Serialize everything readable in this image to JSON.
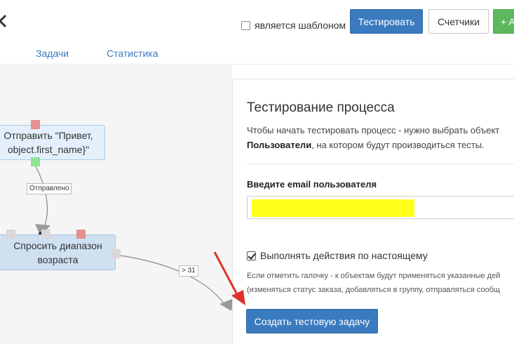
{
  "header": {
    "template_checkbox": {
      "label": "является шаблоном",
      "checked": false
    },
    "test_button": "Тестировать",
    "counters_button": "Счетчики",
    "add_button": "+ A",
    "tabs": [
      {
        "label": "Задачи"
      },
      {
        "label": "Статистика"
      }
    ]
  },
  "canvas": {
    "nodes": [
      {
        "label": "Отправить \"Привет,\nobject.first_name}\""
      },
      {
        "label": "Спросить диапазон\nвозраста"
      }
    ],
    "edge_labels": [
      "Отправлено",
      "> 31"
    ]
  },
  "panel": {
    "title": "Тестирование процесса",
    "desc_line1": "Чтобы начать тестировать процесс - нужно выбрать объект",
    "desc_bold": "Пользователи",
    "desc_rest": ", на котором будут производиться тесты.",
    "email_label": "Введите email пользователя",
    "email_value": "",
    "real_actions": {
      "label": "Выполнять действия по настоящему",
      "checked": true
    },
    "hint_line1": "Если отметить галочку - к объектам будут применяться указанные дей",
    "hint_line2": "(изменяться статус заказа, добавляться в группу, отправляться сообщ",
    "create_button": "Создать тестовую задачу"
  },
  "colors": {
    "primary": "#3a7abf",
    "success": "#5cb85c",
    "highlight": "#ffff1a",
    "annotation_arrow": "#e0322b"
  }
}
